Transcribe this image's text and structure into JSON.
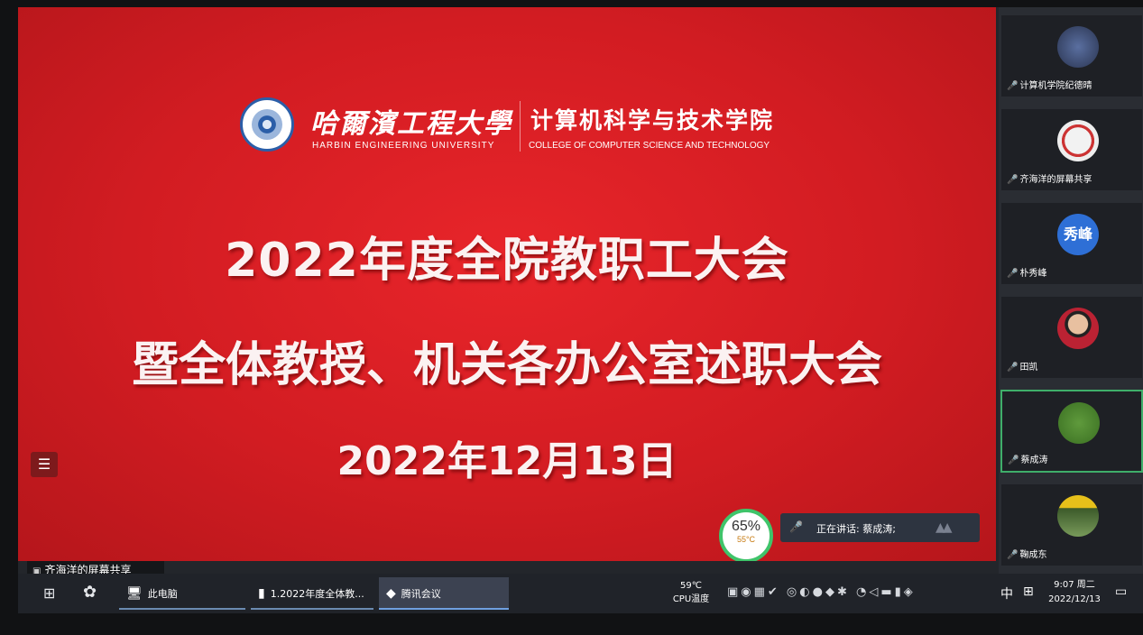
{
  "slide": {
    "university_cn": "哈爾濱工程大學",
    "university_en": "HARBIN ENGINEERING UNIVERSITY",
    "college_cn": "计算机科学与技术学院",
    "college_en": "COLLEGE OF COMPUTER SCIENCE AND TECHNOLOGY",
    "title_line1": "2022年度全院教职工大会",
    "title_line2": "暨全体教授、机关各办公室述职大会",
    "date": "2022年12月13日"
  },
  "overlay": {
    "cpu_percent": "65%",
    "cpu_temp": "55°C",
    "speaking_text": "正在讲话: 蔡成涛;",
    "share_label": "齐海洋的屏幕共享"
  },
  "participants": [
    {
      "name": "计算机学院纪德晴",
      "avatar_text": ""
    },
    {
      "name": "齐海洋的屏幕共享",
      "avatar_text": ""
    },
    {
      "name": "朴秀峰",
      "avatar_text": "秀峰"
    },
    {
      "name": "田凯",
      "avatar_text": ""
    },
    {
      "name": "蔡成涛",
      "avatar_text": ""
    },
    {
      "name": "鞠成东",
      "avatar_text": ""
    }
  ],
  "taskbar": {
    "items": [
      {
        "label": "此电脑",
        "icon": "computer-icon"
      },
      {
        "label": "1.2022年度全体教...",
        "icon": "document-icon"
      },
      {
        "label": "腾讯会议",
        "icon": "tencent-meeting-icon"
      }
    ],
    "cpu_temp": "59℃",
    "cpu_label": "CPU温度",
    "ime_lang": "中",
    "time": "9:07 周二",
    "date": "2022/12/13"
  },
  "colors": {
    "slide_red": "#d21c22",
    "active_border": "#3fae6a",
    "avatar_blue": "#2e6fd6"
  }
}
